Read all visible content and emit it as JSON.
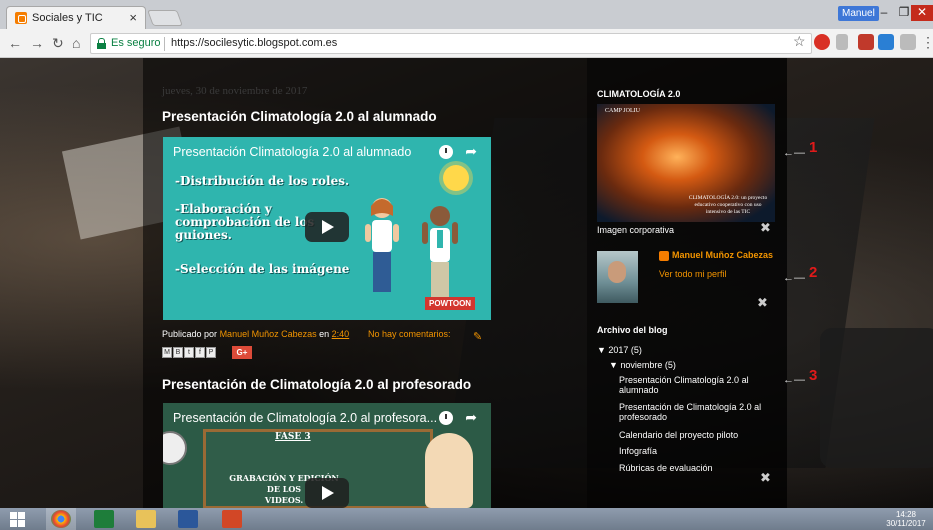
{
  "browser": {
    "tab_title": "Sociales y TIC",
    "tab_close": "×",
    "user_badge": "Manuel",
    "secure_label": "Es seguro",
    "url": "https://socilesytic.blogspot.com.es"
  },
  "blog": {
    "date": "jueves, 30 de noviembre de 2017",
    "post1": {
      "title": "Presentación Climatología 2.0 al alumnado",
      "video_title": "Presentación Climatología 2.0 al alumnado",
      "bullets": [
        "-Distribución de los roles.",
        "-Elaboración y",
        "comprobación de los",
        "guiones.",
        "-Selección de las imágene"
      ],
      "badge": "POWTOON"
    },
    "meta": {
      "published_by": "Publicado por",
      "author": "Manuel Muñoz Cabezas",
      "on": "en",
      "time": "2:40",
      "comments": "No hay comentarios:"
    },
    "post2": {
      "title": "Presentación de Climatología 2.0 al profesorado",
      "video_title": "Presentación de Climatología 2.0 al profesora...",
      "fase": "FASE 3",
      "grab_line1": "GRABACIÓN Y EDICIÓN DE LOS",
      "grab_line2": "VIDEOS."
    }
  },
  "sidebar": {
    "climatologia_heading": "CLIMATOLOGÍA 2.0",
    "corp_image_top": "CAMP JOLIU",
    "corp_image_caption": "CLIMATOLOGÍA 2.0: un proyecto educativo cooperativo con uso intensivo de las TIC",
    "corp_label": "Imagen corporativa",
    "profile_name": "Manuel Muñoz Cabezas",
    "profile_link": "Ver todo mi perfil",
    "archive_heading": "Archivo del blog",
    "year": "▼  2017 (5)",
    "month": "▼  noviembre (5)",
    "posts": [
      "Presentación Climatología 2.0 al alumnado",
      "Presentación de Climatología 2.0 al profesorado",
      "Calendario del proyecto piloto",
      "Infografía",
      "Rúbricas de evaluación"
    ],
    "annotation_numbers": [
      "1",
      "2",
      "3"
    ]
  },
  "taskbar": {
    "time": "14:28",
    "date": "30/11/2017"
  },
  "colors": {
    "link_orange": "#f29400",
    "video_teal": "#2fb5ae",
    "annotation_red": "#e01a1a",
    "taskbar": "#7f8c9c"
  }
}
